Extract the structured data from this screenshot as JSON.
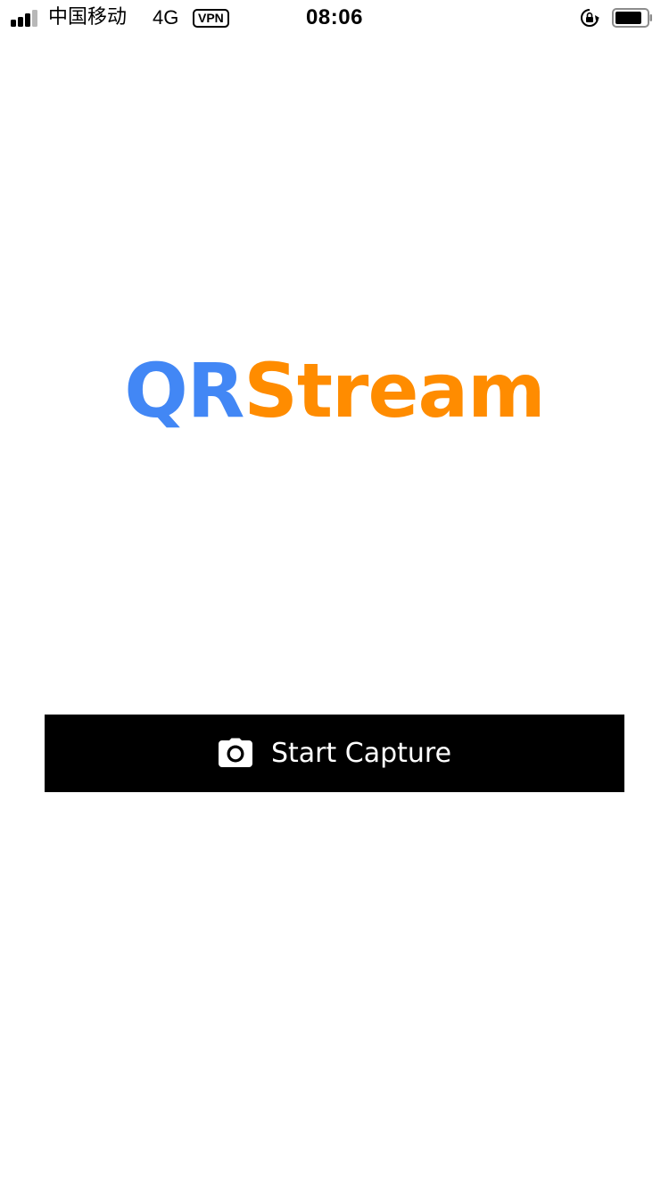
{
  "status_bar": {
    "carrier": "中国移动",
    "network": "4G",
    "vpn": "VPN",
    "time": "08:06",
    "battery_level": 0.85
  },
  "logo": {
    "part1": "QR",
    "part2": "Stream",
    "part1_color": "#4287f5",
    "part2_color": "#ff8c00"
  },
  "capture_button": {
    "label": "Start Capture",
    "icon": "camera-icon",
    "background": "#000000"
  }
}
